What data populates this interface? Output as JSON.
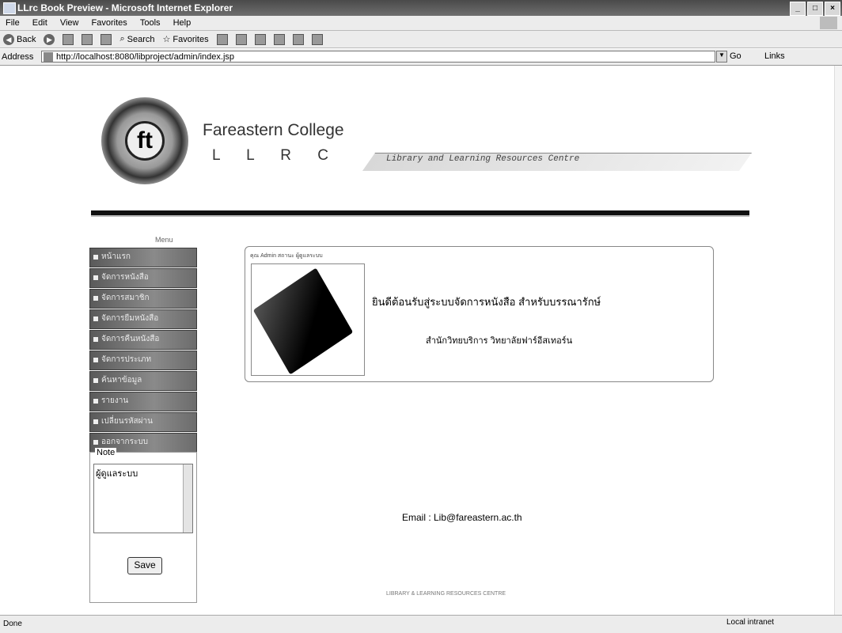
{
  "window": {
    "title": "LLrc Book Preview - Microsoft Internet Explorer"
  },
  "menubar": [
    "File",
    "Edit",
    "View",
    "Favorites",
    "Tools",
    "Help"
  ],
  "toolbar": {
    "back": "Back",
    "search": "Search",
    "favorites": "Favorites"
  },
  "address": {
    "label": "Address",
    "url": "http://localhost:8080/libproject/admin/index.jsp",
    "go": "Go",
    "links": "Links"
  },
  "header": {
    "college": "Fareastern College",
    "llrc": "L L R C",
    "tagline": "Library and Learning Resources Centre",
    "logo_letter": "ft"
  },
  "sidebar": {
    "header": "Menu",
    "items": [
      "หน้าแรก",
      "จัดการหนังสือ",
      "จัดการสมาชิก",
      "จัดการยืมหนังสือ",
      "จัดการคืนหนังสือ",
      "จัดการประเภท",
      "ค้นหาข้อมูล",
      "รายงาน",
      "เปลี่ยนรหัสผ่าน",
      "ออกจากระบบ"
    ]
  },
  "note": {
    "label": "Note",
    "value": "ผู้ดูแลระบบ",
    "save": "Save"
  },
  "welcome": {
    "head": "คุณ Admin สถานะ ผู้ดูแลระบบ",
    "message": "ยินดีต้อนรับสู่ระบบจัดการหนังสือ สำหรับบรรณารักษ์",
    "sub": "สำนักวิทยบริการ วิทยาลัยฟาร์อีสเทอร์น"
  },
  "email": "Email : Lib@fareastern.ac.th",
  "copyright": "LIBRARY & LEARNING RESOURCES CENTRE",
  "status": {
    "left": "Done",
    "right": "Local intranet"
  }
}
